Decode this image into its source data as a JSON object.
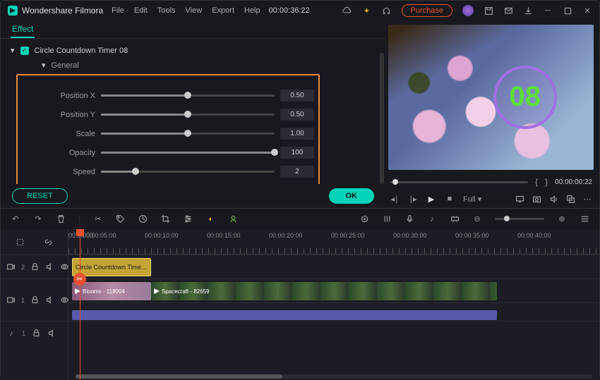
{
  "app": {
    "name": "Wondershare Filmora"
  },
  "menu": {
    "file": "File",
    "edit": "Edit",
    "tools": "Tools",
    "view": "View",
    "export": "Export",
    "help": "Help"
  },
  "timecode_top": "00:00:36:22",
  "purchase_label": "Purchase",
  "tab": {
    "effect": "Effect"
  },
  "effect": {
    "title": "Circle Countdown Timer 08",
    "section": "General",
    "params": {
      "posx": {
        "label": "Position X",
        "value": "0.50",
        "pct": 50
      },
      "posy": {
        "label": "Position Y",
        "value": "0.50",
        "pct": 50
      },
      "scale": {
        "label": "Scale",
        "value": "1.00",
        "pct": 50
      },
      "opacity": {
        "label": "Opacity",
        "value": "100",
        "pct": 100
      },
      "speed": {
        "label": "Speed",
        "value": "2",
        "pct": 20
      }
    },
    "reset": "RESET",
    "ok": "OK"
  },
  "preview": {
    "countdown": "08",
    "timecode": "00:00:00:22",
    "quality": "Full"
  },
  "timeline": {
    "marks": [
      "00:00:00",
      "00:00:05:00",
      "00:00:10:00",
      "00:00:15:00",
      "00:00:20:00",
      "00:00:25:00",
      "00:00:30:00",
      "00:00:35:00",
      "00:00:40:00"
    ],
    "tracks": {
      "v2": {
        "label": "2",
        "lock": "lock",
        "vol": "vol",
        "eye": "eye"
      },
      "v1": {
        "label": "1"
      },
      "a1": {
        "label": "1"
      }
    },
    "clips": {
      "effect": "Circle Countdown Time...",
      "blooms": "Blooms - 118004",
      "spacecraft": "Spacecraft - 82659"
    }
  }
}
